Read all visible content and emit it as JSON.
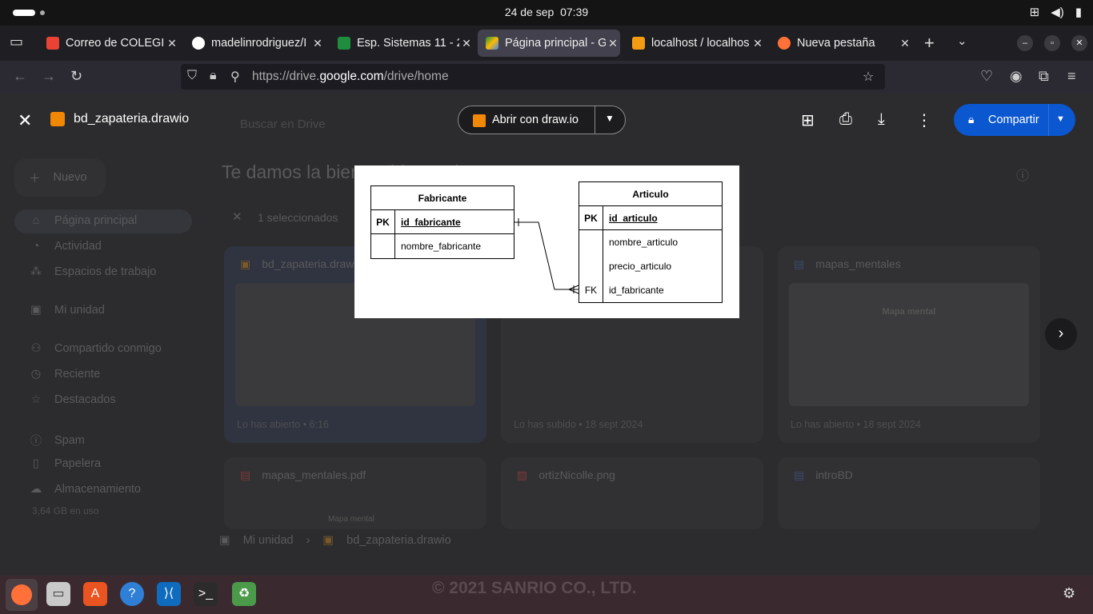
{
  "system": {
    "date": "24 de sep",
    "time": "07:39"
  },
  "tabs": [
    {
      "label": "Correo de COLEGIO",
      "icon": "gmail-icon",
      "color": "#ea4335"
    },
    {
      "label": "madelinrodriguez/I",
      "icon": "github-icon",
      "color": "#ffffff"
    },
    {
      "label": "Esp. Sistemas 11 - 2",
      "icon": "classroom-icon",
      "color": "#1e8e3e"
    },
    {
      "label": "Página principal - G",
      "icon": "drive-icon",
      "color": "#4285f4"
    },
    {
      "label": "localhost / localhos",
      "icon": "phpmyadmin-icon",
      "color": "#f39c12"
    },
    {
      "label": "Nueva pestaña",
      "icon": "firefox-icon",
      "color": "#ff7139"
    }
  ],
  "url": {
    "prefix": "https://drive.",
    "host": "google.com",
    "path": "/drive/home"
  },
  "viewer": {
    "filename": "bd_zapateria.drawio",
    "open_with": "Abrir con draw.io",
    "share": "Compartir"
  },
  "drive": {
    "search_placeholder": "Buscar en Drive",
    "welcome": "Te damos la bienvenida a Drive",
    "new_label": "Nuevo",
    "selected": "1 seleccionados",
    "sidebar": [
      {
        "label": "Página principal",
        "icon": "home-icon"
      },
      {
        "label": "Actividad",
        "icon": "bell-icon"
      },
      {
        "label": "Espacios de trabajo",
        "icon": "workspaces-icon"
      },
      {
        "label": "Mi unidad",
        "icon": "drive-icon"
      },
      {
        "label": "Compartido conmigo",
        "icon": "people-icon"
      },
      {
        "label": "Reciente",
        "icon": "clock-icon"
      },
      {
        "label": "Destacados",
        "icon": "star-icon"
      },
      {
        "label": "Spam",
        "icon": "spam-icon"
      },
      {
        "label": "Papelera",
        "icon": "trash-icon"
      },
      {
        "label": "Almacenamiento",
        "icon": "cloud-icon"
      }
    ],
    "storage": "3,64 GB en uso",
    "cards": [
      {
        "name": "bd_zapateria.drawio",
        "meta": "Lo has abierto • 6:16"
      },
      {
        "name": "",
        "meta": "Lo has subido • 18 sept 2024"
      },
      {
        "name": "mapas_mentales",
        "meta": "Lo has abierto • 18 sept 2024"
      },
      {
        "name": "mapas_mentales.pdf",
        "meta": ""
      },
      {
        "name": "ortizNicolle.png",
        "meta": ""
      },
      {
        "name": "introBD",
        "meta": ""
      }
    ],
    "thumb_texts": {
      "mapa": "Mapa mental",
      "mapa_small": "Mapa mental"
    },
    "breadcrumb": [
      "Mi unidad",
      "bd_zapateria.drawio"
    ]
  },
  "diagram": {
    "fabricante": {
      "title": "Fabricante",
      "pk_key": "PK",
      "pk_field": "id_fabricante",
      "fields": [
        "nombre_fabricante"
      ]
    },
    "articulo": {
      "title": "Articulo",
      "pk_key": "PK",
      "pk_field": "id_articulo",
      "fields": [
        "nombre_articulo",
        "precio_articulo"
      ],
      "fk_key": "FK",
      "fk_field": "id_fabricante"
    }
  },
  "dock": {
    "copyright": "© 2021 SANRIO CO., LTD."
  }
}
